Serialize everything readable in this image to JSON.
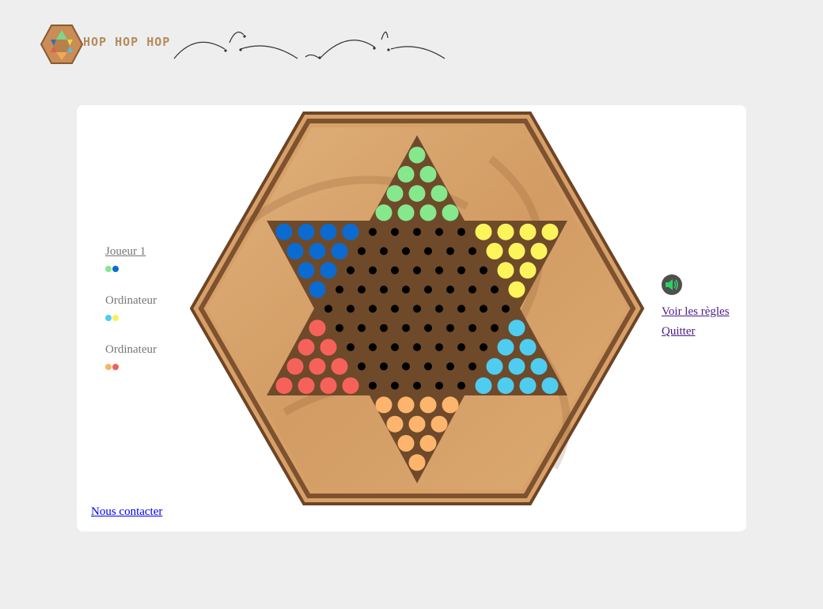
{
  "header": {
    "logo_text": "HOP HOP HOP",
    "logo_icon": "hexagon-star-icon",
    "decoration_icon": "hopping-trail-icon"
  },
  "players": [
    {
      "name": "Joueur 1",
      "current": true,
      "colors": [
        "#86e88c",
        "#0c6bd0"
      ]
    },
    {
      "name": "Ordinateur",
      "current": false,
      "colors": [
        "#4fcdf0",
        "#f5f25a"
      ]
    },
    {
      "name": "Ordinateur",
      "current": false,
      "colors": [
        "#f8b468",
        "#f2605a"
      ]
    }
  ],
  "board": {
    "colors": {
      "green": "#86e88c",
      "blue": "#0c6bd0",
      "yellow": "#fdf45c",
      "cyan": "#4fcdf0",
      "orange": "#fdb46c",
      "red": "#f6625a",
      "empty": "#000000",
      "wood": "#d9a56e",
      "star": "#6e4a2a"
    },
    "rows": [
      "G",
      "GG",
      "GGG",
      "GGGG",
      "BBBB.....YYYY",
      "BBB......YYY",
      "BB.......YY",
      "B........Y",
      ".........",
      "R........C",
      "RR.......CC",
      "RRR......CCC",
      "RRRR.....CCCC",
      "OOOO",
      "OOO",
      "OO",
      "O"
    ]
  },
  "actions": {
    "sound_icon": "speaker-icon",
    "rules": "Voir les règles",
    "quit": "Quitter"
  },
  "footer": {
    "contact": "Nous contacter"
  }
}
